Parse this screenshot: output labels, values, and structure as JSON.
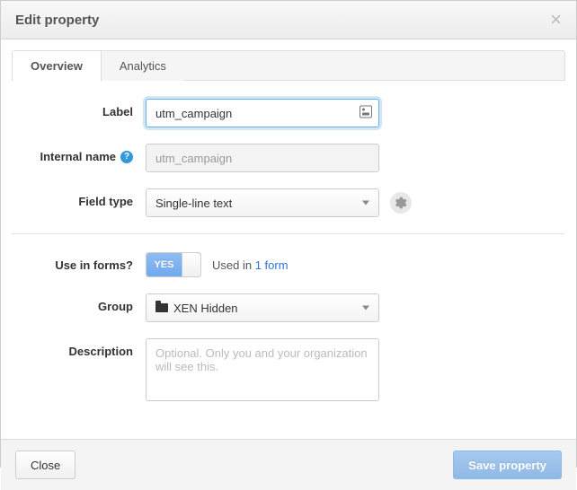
{
  "dialog": {
    "title": "Edit property",
    "tabs": {
      "overview": "Overview",
      "analytics": "Analytics"
    },
    "footer": {
      "close": "Close",
      "save": "Save property"
    }
  },
  "form": {
    "labels": {
      "label": "Label",
      "internal_name": "Internal name",
      "field_type": "Field type",
      "use_in_forms": "Use in forms?",
      "group": "Group",
      "description": "Description"
    },
    "label_value": "utm_campaign",
    "internal_name_value": "utm_campaign",
    "field_type_value": "Single-line text",
    "use_in_forms": {
      "state": "YES",
      "used_in_prefix": "Used in ",
      "used_in_link": "1 form"
    },
    "group_value": "XEN Hidden",
    "description_placeholder": "Optional. Only you and your organization will see this."
  }
}
